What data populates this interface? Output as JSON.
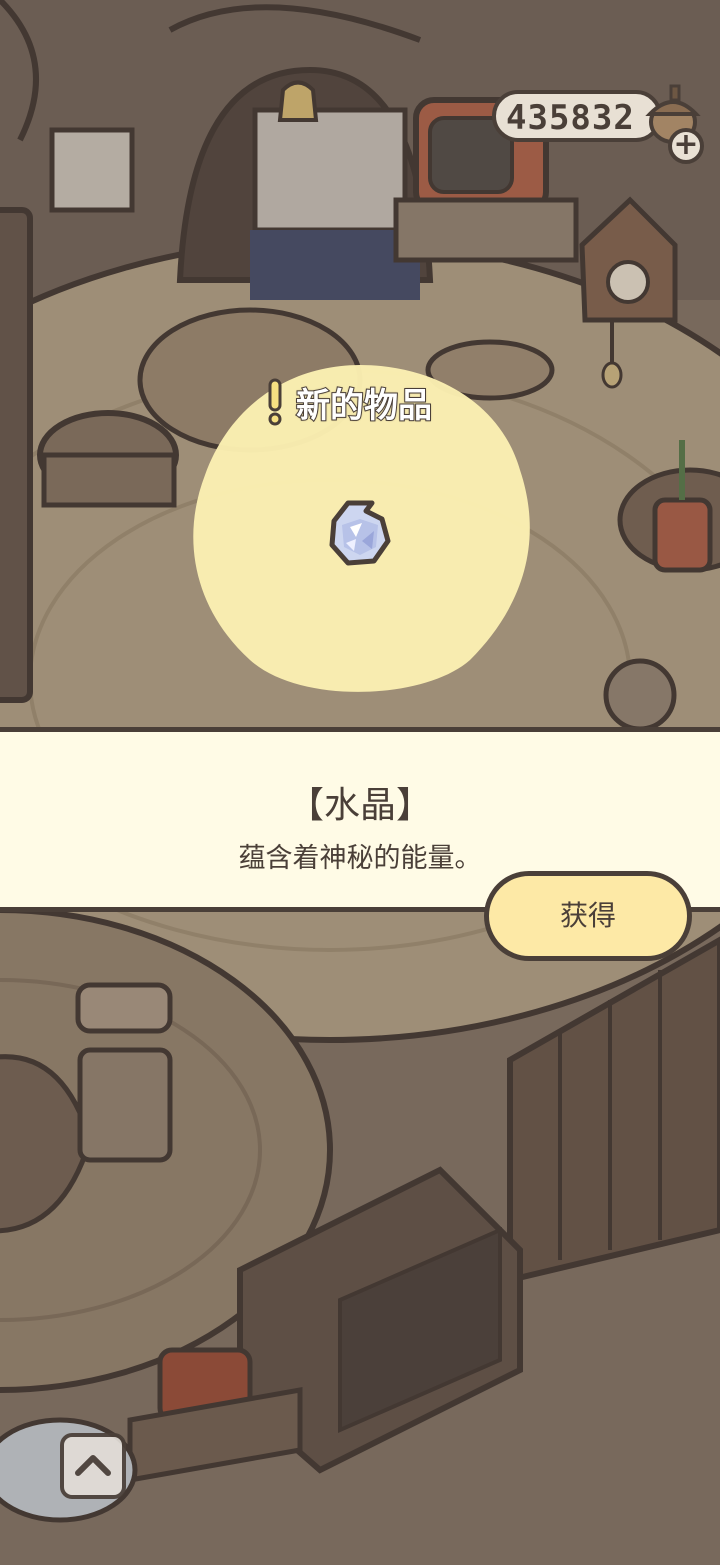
{
  "currency": {
    "value": "435832",
    "add_label": "+"
  },
  "new_item": {
    "header": "新的物品",
    "name": "【水晶】",
    "description": "蕴含着神秘的能量。"
  },
  "actions": {
    "obtain_label": "获得"
  },
  "colors": {
    "outline": "#4a3f38",
    "panel": "#fffbe6",
    "button": "#fde9a6",
    "glow": "#fbf0b2"
  },
  "icons": {
    "crystal": "crystal-icon",
    "collapse": "chevron-up-icon",
    "alert": "exclamation-icon"
  }
}
